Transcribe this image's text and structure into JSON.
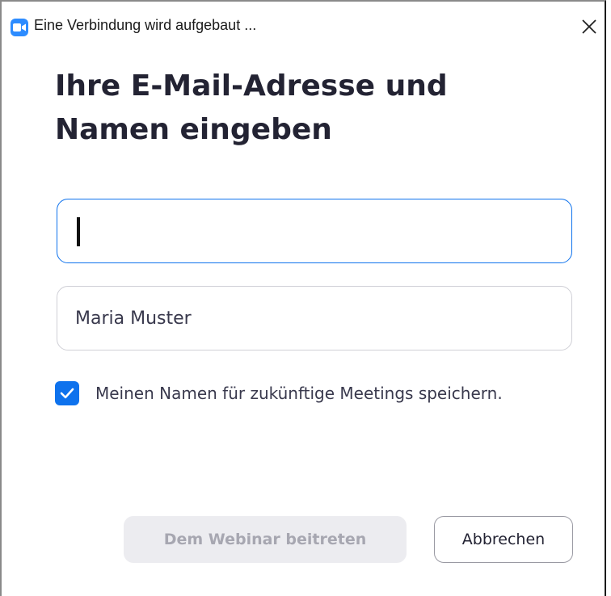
{
  "window": {
    "title": "Eine Verbindung wird aufgebaut ...",
    "icon": "zoom-video-icon",
    "close_icon": "close-icon"
  },
  "form": {
    "heading": "Ihre E-Mail-Adresse und Namen eingeben",
    "email_value": "",
    "name_value": "Maria Muster",
    "remember_checked": true,
    "remember_label": "Meinen Namen für zukünftige Meetings speichern."
  },
  "buttons": {
    "join_label": "Dem Webinar beitreten",
    "join_enabled": false,
    "cancel_label": "Abbrechen"
  },
  "colors": {
    "accent": "#0e72ed",
    "icon_blue": "#2d8cff",
    "heading_text": "#232333",
    "disabled_button_bg": "#ececf0",
    "disabled_button_text": "#a7a7b1"
  }
}
